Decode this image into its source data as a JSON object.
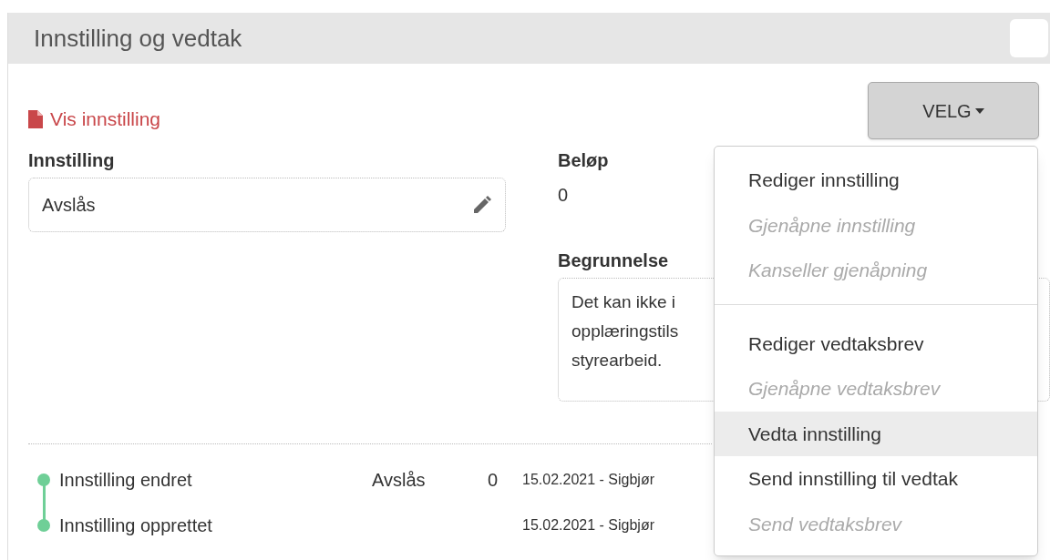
{
  "panel": {
    "title": "Innstilling og vedtak",
    "show_link": "Vis innstilling",
    "menu_button": "VELG",
    "recommendation": {
      "label": "Innstilling",
      "value": "Avslås"
    },
    "amount": {
      "label": "Beløp",
      "value": "0"
    },
    "reason": {
      "label": "Begrunnelse",
      "lines": [
        "Det kan ikke i",
        "opplæringstils",
        "styrearbeid."
      ]
    },
    "menu": {
      "groups": [
        [
          {
            "label": "Rediger innstilling",
            "disabled": false,
            "selected": false
          },
          {
            "label": "Gjenåpne innstilling",
            "disabled": true,
            "selected": false
          },
          {
            "label": "Kanseller gjenåpning",
            "disabled": true,
            "selected": false
          }
        ],
        [
          {
            "label": "Rediger vedtaksbrev",
            "disabled": false,
            "selected": false
          },
          {
            "label": "Gjenåpne vedtaksbrev",
            "disabled": true,
            "selected": false
          },
          {
            "label": "Vedta innstilling",
            "disabled": false,
            "selected": true
          },
          {
            "label": "Send innstilling til vedtak",
            "disabled": false,
            "selected": false
          },
          {
            "label": "Send vedtaksbrev",
            "disabled": true,
            "selected": false
          }
        ]
      ]
    },
    "history": [
      {
        "event": "Innstilling endret",
        "result": "Avslås",
        "amount": "0",
        "date_author": "15.02.2021 - Sigbjør"
      },
      {
        "event": "Innstilling opprettet",
        "date_author": "15.02.2021 - Sigbjør"
      }
    ]
  }
}
